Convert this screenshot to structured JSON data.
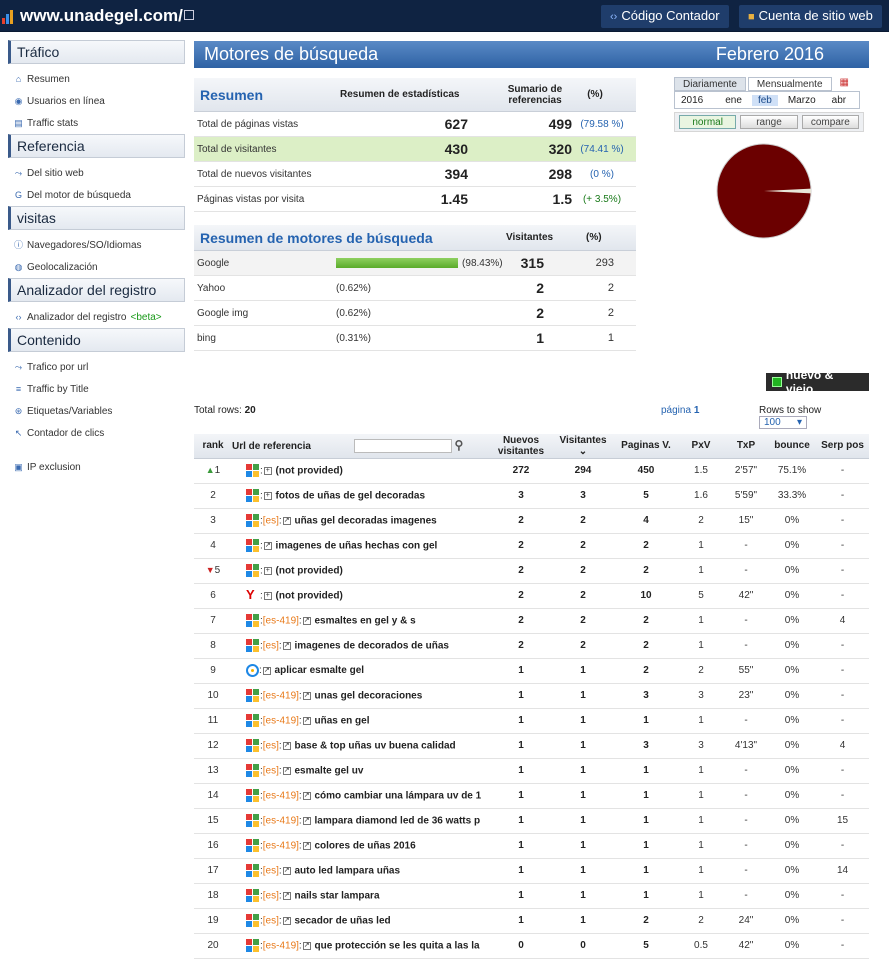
{
  "topbar": {
    "site": "www.unadegel.com/",
    "btn_counter": "Código Contador",
    "btn_account": "Cuenta de sitio web"
  },
  "sidebar": [
    {
      "title": "Tráfico",
      "items": [
        {
          "label": "Resumen",
          "icon": "home-icon"
        },
        {
          "label": "Usuarios en línea",
          "icon": "live-icon"
        },
        {
          "label": "Traffic stats",
          "icon": "stats-icon"
        }
      ]
    },
    {
      "title": "Referencia",
      "items": [
        {
          "label": "Del sitio web",
          "icon": "link-icon"
        },
        {
          "label": "Del motor de búsqueda",
          "icon": "google-icon"
        }
      ]
    },
    {
      "title": "visitas",
      "items": [
        {
          "label": "Navegadores/SO/Idiomas",
          "icon": "info-icon"
        },
        {
          "label": "Geolocalización",
          "icon": "globe-icon"
        }
      ]
    },
    {
      "title": "Analizador del registro",
      "items": [
        {
          "label": "Analizador del registro",
          "beta": "<beta>",
          "icon": "code-icon"
        }
      ]
    },
    {
      "title": "Contenido",
      "items": [
        {
          "label": "Trafico por url",
          "icon": "link-icon"
        },
        {
          "label": "Traffic by Title",
          "icon": "title-icon"
        },
        {
          "label": "Etiquetas/Variables",
          "icon": "tag-icon"
        },
        {
          "label": "Contador de clics",
          "icon": "cursor-icon"
        },
        {
          "label": "IP exclusion",
          "icon": "ip-icon"
        }
      ]
    }
  ],
  "header": {
    "title": "Motores de búsqueda",
    "period": "Febrero 2016"
  },
  "summary": {
    "title": "Resumen",
    "col1": "Resumen de estadísticas",
    "col2": "Sumario de referencias",
    "col3": "(%)",
    "rows": [
      {
        "label": "Total de páginas vistas",
        "a": "627",
        "b": "499",
        "p": "(79.58 %)"
      },
      {
        "label": "Total de visitantes",
        "a": "430",
        "b": "320",
        "p": "(74.41 %)"
      },
      {
        "label": "Total de nuevos visitantes",
        "a": "394",
        "b": "298",
        "p": "(0 %)"
      },
      {
        "label": "Páginas vistas por visita",
        "a": "1.45",
        "b": "1.5",
        "p": "(+ 3.5%)"
      }
    ]
  },
  "engines": {
    "title": "Resumen de motores de búsqueda",
    "col1": "Visitantes",
    "col2": "(%)",
    "rows": [
      {
        "name": "Google",
        "pct": "(98.43%)",
        "share": 0.9843,
        "visitors": "315",
        "other": "293"
      },
      {
        "name": "Yahoo",
        "pct": "(0.62%)",
        "share": 0.0062,
        "visitors": "2",
        "other": "2"
      },
      {
        "name": "Google img",
        "pct": "(0.62%)",
        "share": 0.0062,
        "visitors": "2",
        "other": "2"
      },
      {
        "name": "bing",
        "pct": "(0.31%)",
        "share": 0.0031,
        "visitors": "1",
        "other": "1"
      }
    ]
  },
  "period_picker": {
    "tab1": "Diariamente",
    "tab2": "Mensualmente",
    "year": "2016",
    "months": [
      "ene",
      "feb",
      "Marzo",
      "abr"
    ],
    "selected": "feb",
    "buttons": [
      "normal",
      "range",
      "compare"
    ]
  },
  "pie": {
    "google_share": 0.9843,
    "color_main": "#6b0000",
    "color_rest": "#e8e6d8"
  },
  "legend_button": "nuevo & viejo",
  "table_info": {
    "total_label": "Total rows:",
    "total": "20",
    "page_label": "página",
    "page": "1",
    "rows_label": "Rows to show",
    "rows_value": "100"
  },
  "table": {
    "headers": {
      "rank": "rank",
      "url": "Url de referencia",
      "new": "Nuevos visitantes",
      "visitors": "Visitantes",
      "pages": "Paginas V.",
      "pxv": "PxV",
      "txp": "TxP",
      "bounce": "bounce",
      "serp": "Serp pos"
    },
    "rows": [
      {
        "rank": "1",
        "trend": "up",
        "engine": "google",
        "lang": "",
        "url": "(not provided)",
        "new": "272",
        "vis": "294",
        "pv": "450",
        "pxv": "1.5",
        "txp": "2'57\"",
        "bounce": "75.1%",
        "serp": "-"
      },
      {
        "rank": "2",
        "trend": "",
        "engine": "google",
        "lang": "",
        "url": "fotos de uñas de gel decoradas",
        "new": "3",
        "vis": "3",
        "pv": "5",
        "pxv": "1.6",
        "txp": "5'59\"",
        "bounce": "33.3%",
        "serp": "-"
      },
      {
        "rank": "3",
        "trend": "",
        "engine": "google",
        "lang": "[es]",
        "url": "uñas gel decoradas imagenes",
        "new": "2",
        "vis": "2",
        "pv": "4",
        "pxv": "2",
        "txp": "15\"",
        "bounce": "0%",
        "serp": "-"
      },
      {
        "rank": "4",
        "trend": "",
        "engine": "google",
        "lang": "",
        "url": "imagenes de uñas hechas con gel",
        "new": "2",
        "vis": "2",
        "pv": "2",
        "pxv": "1",
        "txp": "-",
        "bounce": "0%",
        "serp": "-"
      },
      {
        "rank": "5",
        "trend": "down",
        "engine": "google",
        "lang": "",
        "url": "(not provided)",
        "new": "2",
        "vis": "2",
        "pv": "2",
        "pxv": "1",
        "txp": "-",
        "bounce": "0%",
        "serp": "-"
      },
      {
        "rank": "6",
        "trend": "",
        "engine": "yahoo",
        "lang": "",
        "url": "(not provided)",
        "new": "2",
        "vis": "2",
        "pv": "10",
        "pxv": "5",
        "txp": "42\"",
        "bounce": "0%",
        "serp": "-"
      },
      {
        "rank": "7",
        "trend": "",
        "engine": "google",
        "lang": "[es-419]",
        "url": "esmaltes en gel y & s",
        "new": "2",
        "vis": "2",
        "pv": "2",
        "pxv": "1",
        "txp": "-",
        "bounce": "0%",
        "serp": "4"
      },
      {
        "rank": "8",
        "trend": "",
        "engine": "google",
        "lang": "[es]",
        "url": "imagenes de decorados de uñas",
        "new": "2",
        "vis": "2",
        "pv": "2",
        "pxv": "1",
        "txp": "-",
        "bounce": "0%",
        "serp": "-"
      },
      {
        "rank": "9",
        "trend": "",
        "engine": "bing",
        "lang": "",
        "url": "aplicar esmalte gel",
        "new": "1",
        "vis": "1",
        "pv": "2",
        "pxv": "2",
        "txp": "55\"",
        "bounce": "0%",
        "serp": "-"
      },
      {
        "rank": "10",
        "trend": "",
        "engine": "google",
        "lang": "[es-419]",
        "url": "unas gel decoraciones",
        "new": "1",
        "vis": "1",
        "pv": "3",
        "pxv": "3",
        "txp": "23\"",
        "bounce": "0%",
        "serp": "-"
      },
      {
        "rank": "11",
        "trend": "",
        "engine": "google",
        "lang": "[es-419]",
        "url": "uñas en gel",
        "new": "1",
        "vis": "1",
        "pv": "1",
        "pxv": "1",
        "txp": "-",
        "bounce": "0%",
        "serp": "-"
      },
      {
        "rank": "12",
        "trend": "",
        "engine": "google",
        "lang": "[es]",
        "url": "base & top uñas uv buena calidad",
        "new": "1",
        "vis": "1",
        "pv": "3",
        "pxv": "3",
        "txp": "4'13\"",
        "bounce": "0%",
        "serp": "4"
      },
      {
        "rank": "13",
        "trend": "",
        "engine": "google",
        "lang": "[es]",
        "url": "esmalte gel uv",
        "new": "1",
        "vis": "1",
        "pv": "1",
        "pxv": "1",
        "txp": "-",
        "bounce": "0%",
        "serp": "-"
      },
      {
        "rank": "14",
        "trend": "",
        "engine": "google",
        "lang": "[es-419]",
        "url": "cómo cambiar una lámpara uv de 1",
        "new": "1",
        "vis": "1",
        "pv": "1",
        "pxv": "1",
        "txp": "-",
        "bounce": "0%",
        "serp": "-"
      },
      {
        "rank": "15",
        "trend": "",
        "engine": "google",
        "lang": "[es-419]",
        "url": "lampara diamond led de 36 watts p",
        "new": "1",
        "vis": "1",
        "pv": "1",
        "pxv": "1",
        "txp": "-",
        "bounce": "0%",
        "serp": "15"
      },
      {
        "rank": "16",
        "trend": "",
        "engine": "google",
        "lang": "[es-419]",
        "url": "colores de uñas 2016",
        "new": "1",
        "vis": "1",
        "pv": "1",
        "pxv": "1",
        "txp": "-",
        "bounce": "0%",
        "serp": "-"
      },
      {
        "rank": "17",
        "trend": "",
        "engine": "google",
        "lang": "[es]",
        "url": "auto led lampara uñas",
        "new": "1",
        "vis": "1",
        "pv": "1",
        "pxv": "1",
        "txp": "-",
        "bounce": "0%",
        "serp": "14"
      },
      {
        "rank": "18",
        "trend": "",
        "engine": "google",
        "lang": "[es]",
        "url": "nails star lampara",
        "new": "1",
        "vis": "1",
        "pv": "1",
        "pxv": "1",
        "txp": "-",
        "bounce": "0%",
        "serp": "-"
      },
      {
        "rank": "19",
        "trend": "",
        "engine": "google",
        "lang": "[es]",
        "url": "secador de uñas led",
        "new": "1",
        "vis": "1",
        "pv": "2",
        "pxv": "2",
        "txp": "24\"",
        "bounce": "0%",
        "serp": "-"
      },
      {
        "rank": "20",
        "trend": "",
        "engine": "google",
        "lang": "[es-419]",
        "url": "que protección se les quita a las la",
        "new": "0",
        "vis": "0",
        "pv": "5",
        "pxv": "0.5",
        "txp": "42\"",
        "bounce": "0%",
        "serp": "-"
      }
    ]
  }
}
